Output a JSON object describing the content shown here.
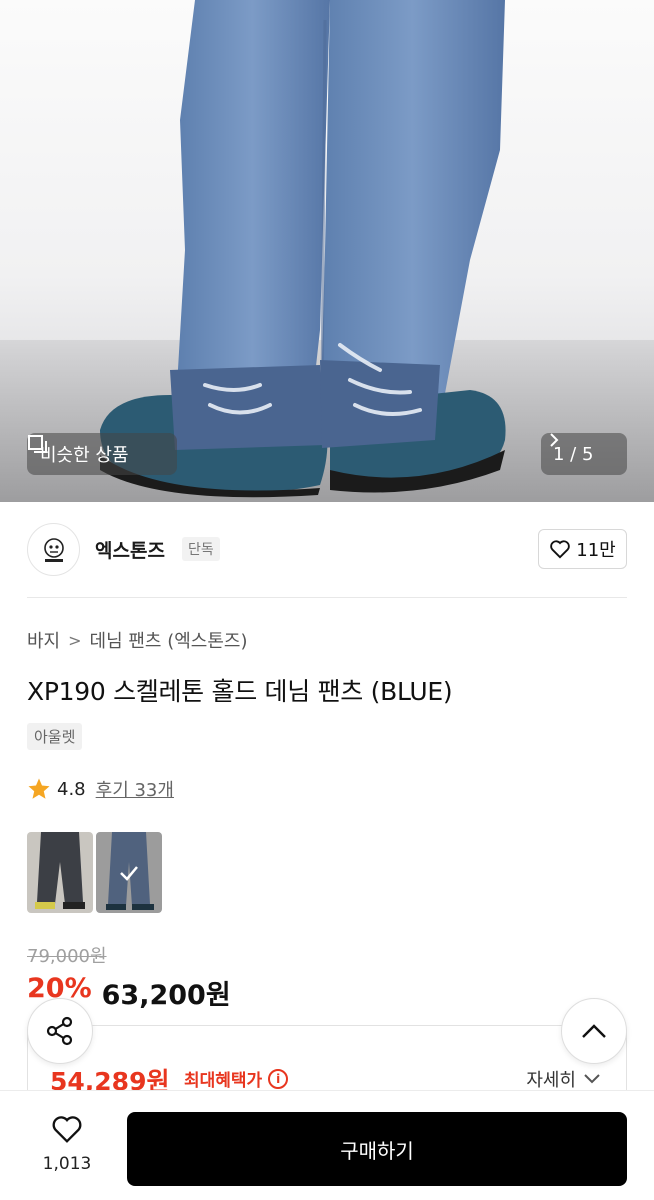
{
  "gallery": {
    "similar_label": "비슷한 상품",
    "counter": "1 / 5"
  },
  "brand": {
    "name": "엑스톤즈",
    "badge": "단독",
    "likes": "11만"
  },
  "breadcrumb": {
    "category": "바지",
    "subcategory": "데님 팬츠 (엑스톤즈)"
  },
  "product": {
    "title": "XP190 스켈레톤 홀드 데님 팬츠 (BLUE)",
    "tag": "아울렛",
    "rating": "4.8",
    "reviews": "후기 33개"
  },
  "price": {
    "original": "79,000원",
    "discount": "20%",
    "sale": "63,200원",
    "benefit_price": "54,289원",
    "benefit_label": "최대혜택가",
    "detail_label": "자세히"
  },
  "bottom_bar": {
    "wish_count": "1,013",
    "buy_label": "구매하기"
  },
  "colors": {
    "accent_red": "#e8361f",
    "buy_button": "#000000",
    "star": "#f5a623"
  },
  "icons": [
    "similar-icon",
    "chevron-right-icon",
    "heart-icon",
    "star-icon",
    "check-icon",
    "share-icon",
    "chevron-up-icon",
    "chevron-down-icon",
    "info-icon"
  ]
}
